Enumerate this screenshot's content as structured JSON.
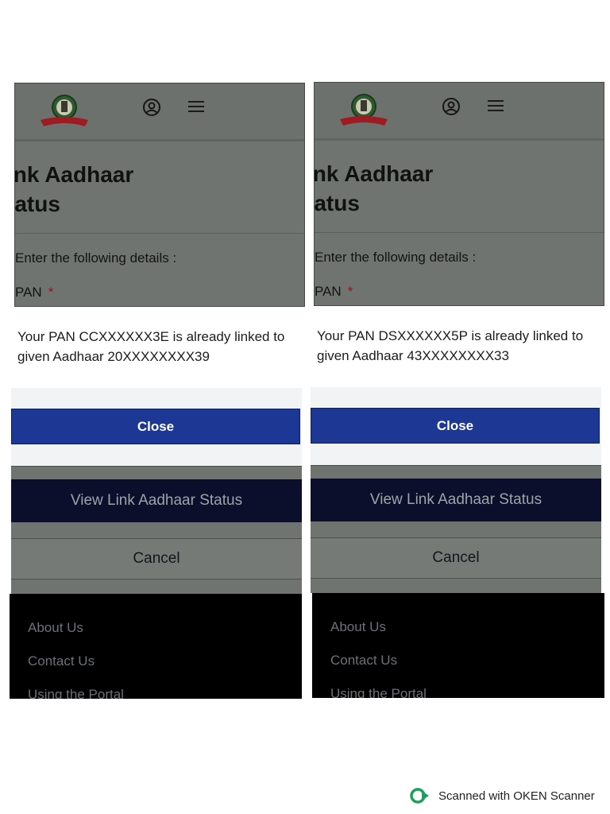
{
  "panels": [
    {
      "heading_line1": "ink Aadhaar",
      "heading_line2": "tatus",
      "subtitle": "Enter the following details :",
      "pan_label": "PAN",
      "required_mark": "*",
      "message_line1": "Your PAN CCXXXXXX3E is already linked to",
      "message_line2": "given Aadhaar 20XXXXXXXX39",
      "close_label": "Close",
      "view_label": "View Link Aadhaar Status",
      "cancel_label": "Cancel",
      "footer_links": [
        "About Us",
        "Contact Us",
        "Using the Portal"
      ]
    },
    {
      "heading_line1": "ink Aadhaar",
      "heading_line2": "tatus",
      "subtitle": "Enter the following details :",
      "pan_label": "PAN",
      "required_mark": "*",
      "message_line1": "Your PAN DSXXXXXX5P is already linked to",
      "message_line2": "given Aadhaar 43XXXXXXXX33",
      "close_label": "Close",
      "view_label": "View Link Aadhaar Status",
      "cancel_label": "Cancel",
      "footer_links": [
        "About Us",
        "Contact Us",
        "Using the Portal"
      ]
    }
  ],
  "icons": {
    "emblem": "income-tax-emblem-icon",
    "account": "account-circle-icon",
    "menu": "hamburger-menu-icon"
  },
  "colors": {
    "close_button": "#1d3795",
    "view_button": "#0b0f2b",
    "required": "#a0111a",
    "footer": "#000000"
  },
  "scanner_text": "Scanned with OKEN Scanner"
}
